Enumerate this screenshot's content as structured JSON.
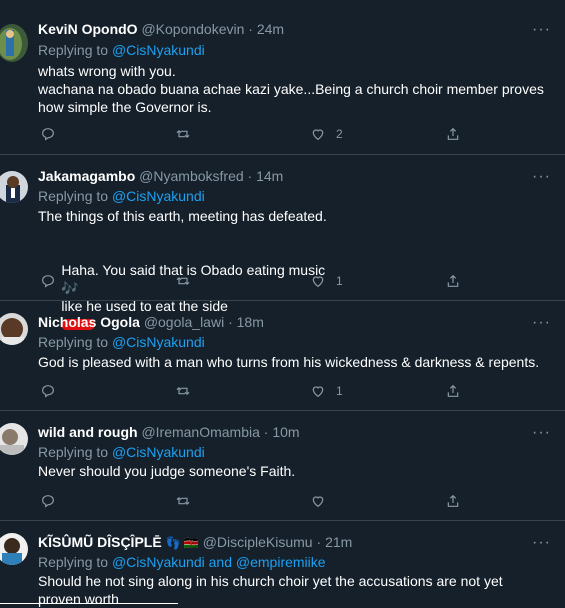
{
  "tweets": [
    {
      "name": "KeviN OpondO",
      "handle": "@Kopondokevin",
      "time": "24m",
      "replying_prefix": "Replying to",
      "replying_to": "@CisNyakundi",
      "text": "whats wrong with you.\nwachana na obado buana achae kazi yake...Being a church choir member proves how simple the Governor is.",
      "likes": "2",
      "retweets": "",
      "replies": ""
    },
    {
      "name": "Jakamagambo",
      "handle": "@Nyamboksfred",
      "time": "14m",
      "replying_prefix": "Replying to",
      "replying_to": "@CisNyakundi",
      "text_line1": "The things of this earth, meeting has defeated.",
      "text_line2": "Haha. You said that is Obado eating music",
      "text_line2b": "like he used to eat the side",
      "music_emoji": "🎶",
      "likes": "1",
      "retweets": "",
      "replies": ""
    },
    {
      "name": "Nicholas Ogola",
      "handle": "@ogola_lawi",
      "time": "18m",
      "replying_prefix": "Replying to",
      "replying_to": "@CisNyakundi",
      "text": "God is pleased with a man who turns from his wickedness & darkness & repents.",
      "likes": "1",
      "retweets": "",
      "replies": ""
    },
    {
      "name": "wild and rough",
      "handle": "@IremanOmambia",
      "time": "10m",
      "replying_prefix": "Replying to",
      "replying_to": "@CisNyakundi",
      "text": "Never should you judge someone's Faith.",
      "likes": "",
      "retweets": "",
      "replies": ""
    },
    {
      "name": "KĨSÛMŨ DÎSÇÎPLĒ",
      "name_emoji": "👣 🇰🇪",
      "handle": "@DiscipleKisumu",
      "time": "21m",
      "replying_prefix": "Replying to",
      "replying_to": "@CisNyakundi",
      "replying_and": "and",
      "replying_to2": "@empiremiike",
      "text": "Should he not sing along in his church choir yet the accusations are not yet proven worth"
    }
  ],
  "ui": {
    "dot": "·",
    "more": "···"
  }
}
